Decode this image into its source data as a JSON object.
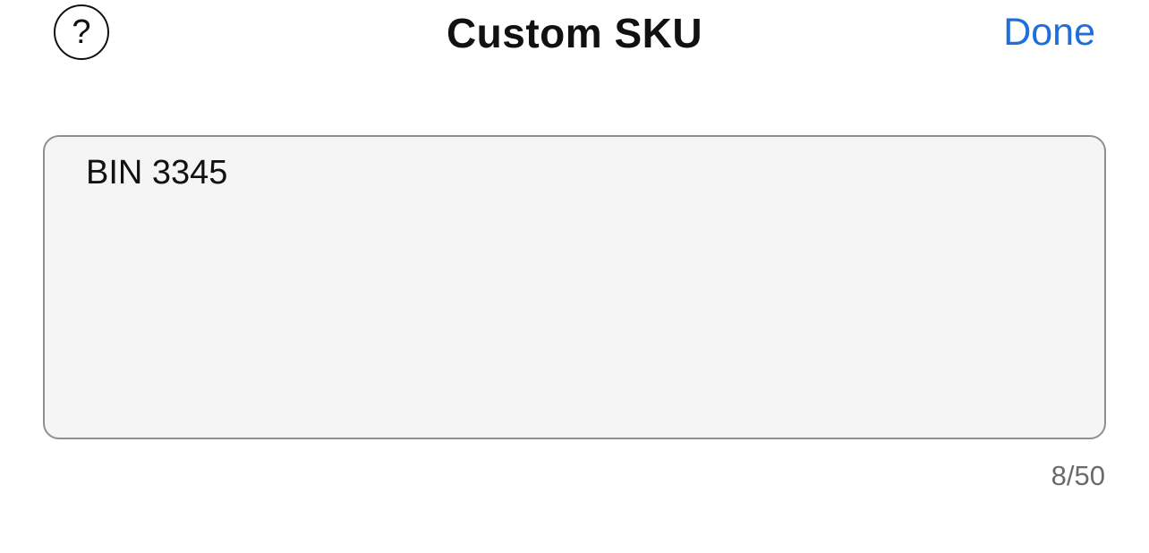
{
  "header": {
    "help_icon": "question-circle-icon",
    "help_glyph": "?",
    "title": "Custom SKU",
    "done_label": "Done"
  },
  "sku": {
    "value": "BIN 3345",
    "counter": "8/50"
  },
  "colors": {
    "accent": "#1e6fd9",
    "field_background": "#f5f5f5",
    "field_border": "#8f8f8f",
    "counter_text": "#6b6b6b"
  }
}
